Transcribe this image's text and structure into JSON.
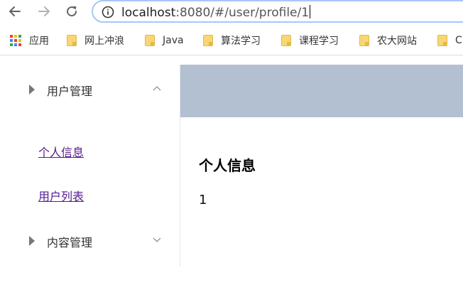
{
  "browser": {
    "address_bar": {
      "host": "localhost",
      "rest": ":8080/#/user/profile/1"
    },
    "bookmarks": [
      {
        "label": "应用",
        "icon": "apps-grid-icon"
      },
      {
        "label": "网上冲浪",
        "icon": "folder-icon"
      },
      {
        "label": "Java",
        "icon": "folder-icon"
      },
      {
        "label": "算法学习",
        "icon": "folder-icon"
      },
      {
        "label": "课程学习",
        "icon": "folder-icon"
      },
      {
        "label": "农大网站",
        "icon": "folder-icon"
      },
      {
        "label": "C",
        "icon": "folder-icon"
      }
    ]
  },
  "sidebar": {
    "groups": [
      {
        "title": "用户管理",
        "expanded": true,
        "items": [
          {
            "label": "个人信息"
          },
          {
            "label": "用户列表"
          }
        ]
      },
      {
        "title": "内容管理",
        "expanded": false,
        "items": []
      }
    ]
  },
  "main": {
    "title": "个人信息",
    "value": "1"
  },
  "colors": {
    "header_band": "#b3c0d1",
    "link_visited": "#551a8b",
    "omnibox_border": "#a8c7fa"
  }
}
